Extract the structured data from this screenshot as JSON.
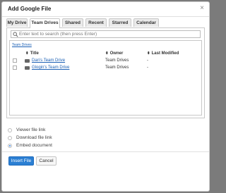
{
  "dialog": {
    "title": "Add Google File",
    "close_glyph": "×"
  },
  "tabs": [
    {
      "label": "My Drive"
    },
    {
      "label": "Team Drives",
      "active": true
    },
    {
      "label": "Shared"
    },
    {
      "label": "Recent"
    },
    {
      "label": "Starred"
    },
    {
      "label": "Calendar"
    }
  ],
  "search": {
    "placeholder": "Enter text to search (then press Enter)",
    "value": ""
  },
  "breadcrumb": "Team Drives",
  "columns": {
    "title": "Title",
    "owner": "Owner",
    "modified": "Last Modified",
    "sort_glyph": "⬍"
  },
  "rows": [
    {
      "title": "Dan's Team Drive",
      "owner": "Team Drives",
      "modified": "-"
    },
    {
      "title": "Glogin's Team Drive",
      "owner": "Team Drives",
      "modified": "-"
    }
  ],
  "options": [
    {
      "label": "Viewer file link",
      "checked": false
    },
    {
      "label": "Download file link",
      "checked": false
    },
    {
      "label": "Embed document",
      "checked": true
    }
  ],
  "buttons": {
    "insert": "Insert File",
    "cancel": "Cancel"
  },
  "colors": {
    "primary": "#2b7fd3",
    "link": "#1a5fb4",
    "overlay": "#7b7b7b"
  }
}
